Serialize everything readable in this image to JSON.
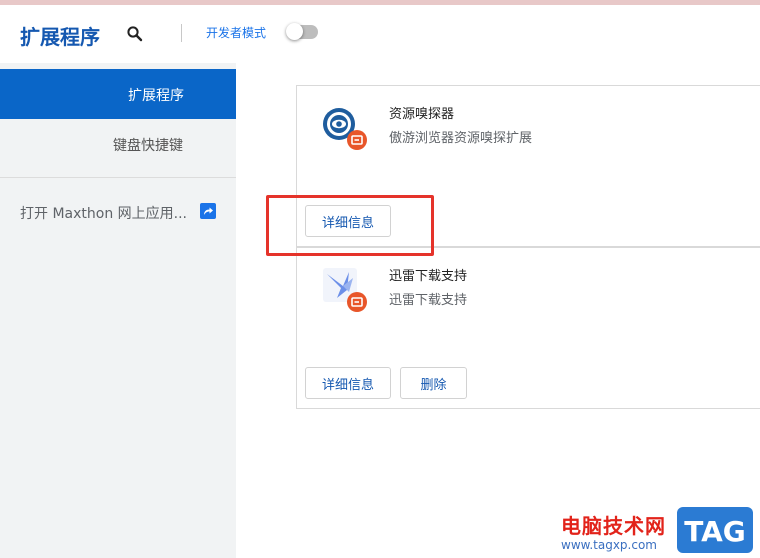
{
  "header": {
    "title": "扩展程序",
    "developer_mode_label": "开发者模式",
    "developer_mode_on": false
  },
  "sidebar": {
    "items": [
      {
        "label": "扩展程序",
        "active": true
      },
      {
        "label": "键盘快捷键",
        "active": false
      }
    ],
    "open_store_label": "打开 Maxthon 网上应用..."
  },
  "extensions": [
    {
      "name": "资源嗅探器",
      "description": "傲游浏览器资源嗅探扩展",
      "details_label": "详细信息"
    },
    {
      "name": "迅雷下载支持",
      "description": "迅雷下载支持",
      "details_label": "详细信息",
      "remove_label": "删除"
    }
  ],
  "watermark": {
    "site_name": "电脑技术网",
    "url": "www.tagxp.com",
    "logo_text": "TAG"
  },
  "colors": {
    "accent": "#1a73e8",
    "sidebar_active": "#0a66c8",
    "highlight_box": "#e5332a",
    "badge": "#e8562a"
  }
}
